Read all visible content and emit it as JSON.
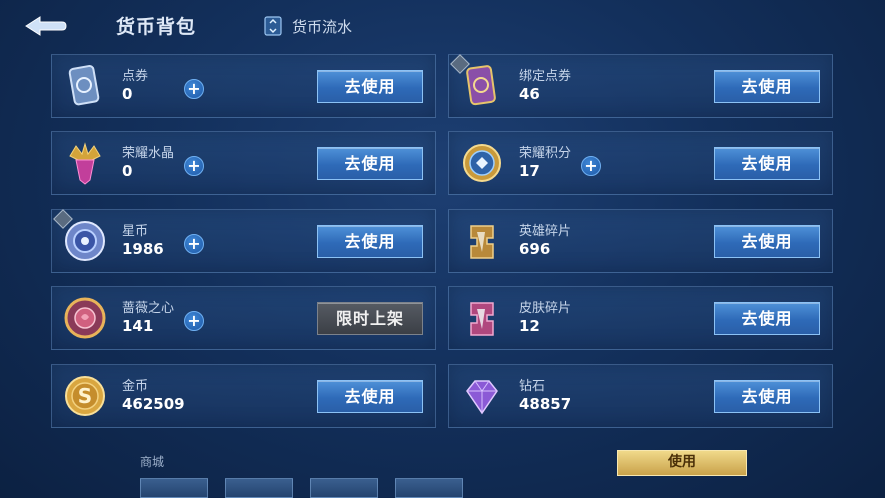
{
  "header": {
    "title": "货币背包",
    "flow_tab": "货币流水"
  },
  "currencies": [
    {
      "name": "点券",
      "amount": "0",
      "button": "去使用",
      "icon": "voucher-card-icon"
    },
    {
      "name": "绑定点券",
      "amount": "46",
      "button": "去使用",
      "icon": "bound-voucher-card-icon"
    },
    {
      "name": "荣耀水晶",
      "amount": "0",
      "button": "去使用",
      "icon": "glory-crystal-icon"
    },
    {
      "name": "荣耀积分",
      "amount": "17",
      "button": "去使用",
      "icon": "glory-points-icon"
    },
    {
      "name": "星币",
      "amount": "1986",
      "button": "去使用",
      "icon": "star-coin-icon"
    },
    {
      "name": "英雄碎片",
      "amount": "696",
      "button": "去使用",
      "icon": "hero-fragment-icon"
    },
    {
      "name": "蔷薇之心",
      "amount": "141",
      "button": "限时上架",
      "icon": "rose-heart-icon"
    },
    {
      "name": "皮肤碎片",
      "amount": "12",
      "button": "去使用",
      "icon": "skin-fragment-icon"
    },
    {
      "name": "金币",
      "amount": "462509",
      "button": "去使用",
      "icon": "gold-coin-icon"
    },
    {
      "name": "钻石",
      "amount": "48857",
      "button": "去使用",
      "icon": "diamond-icon"
    }
  ],
  "bottom": {
    "label": "商城",
    "button": "使用"
  },
  "colors": {
    "button_blue": "#2e6ab8",
    "button_disabled": "#3b3f46",
    "gold_button": "#c9a24a"
  }
}
